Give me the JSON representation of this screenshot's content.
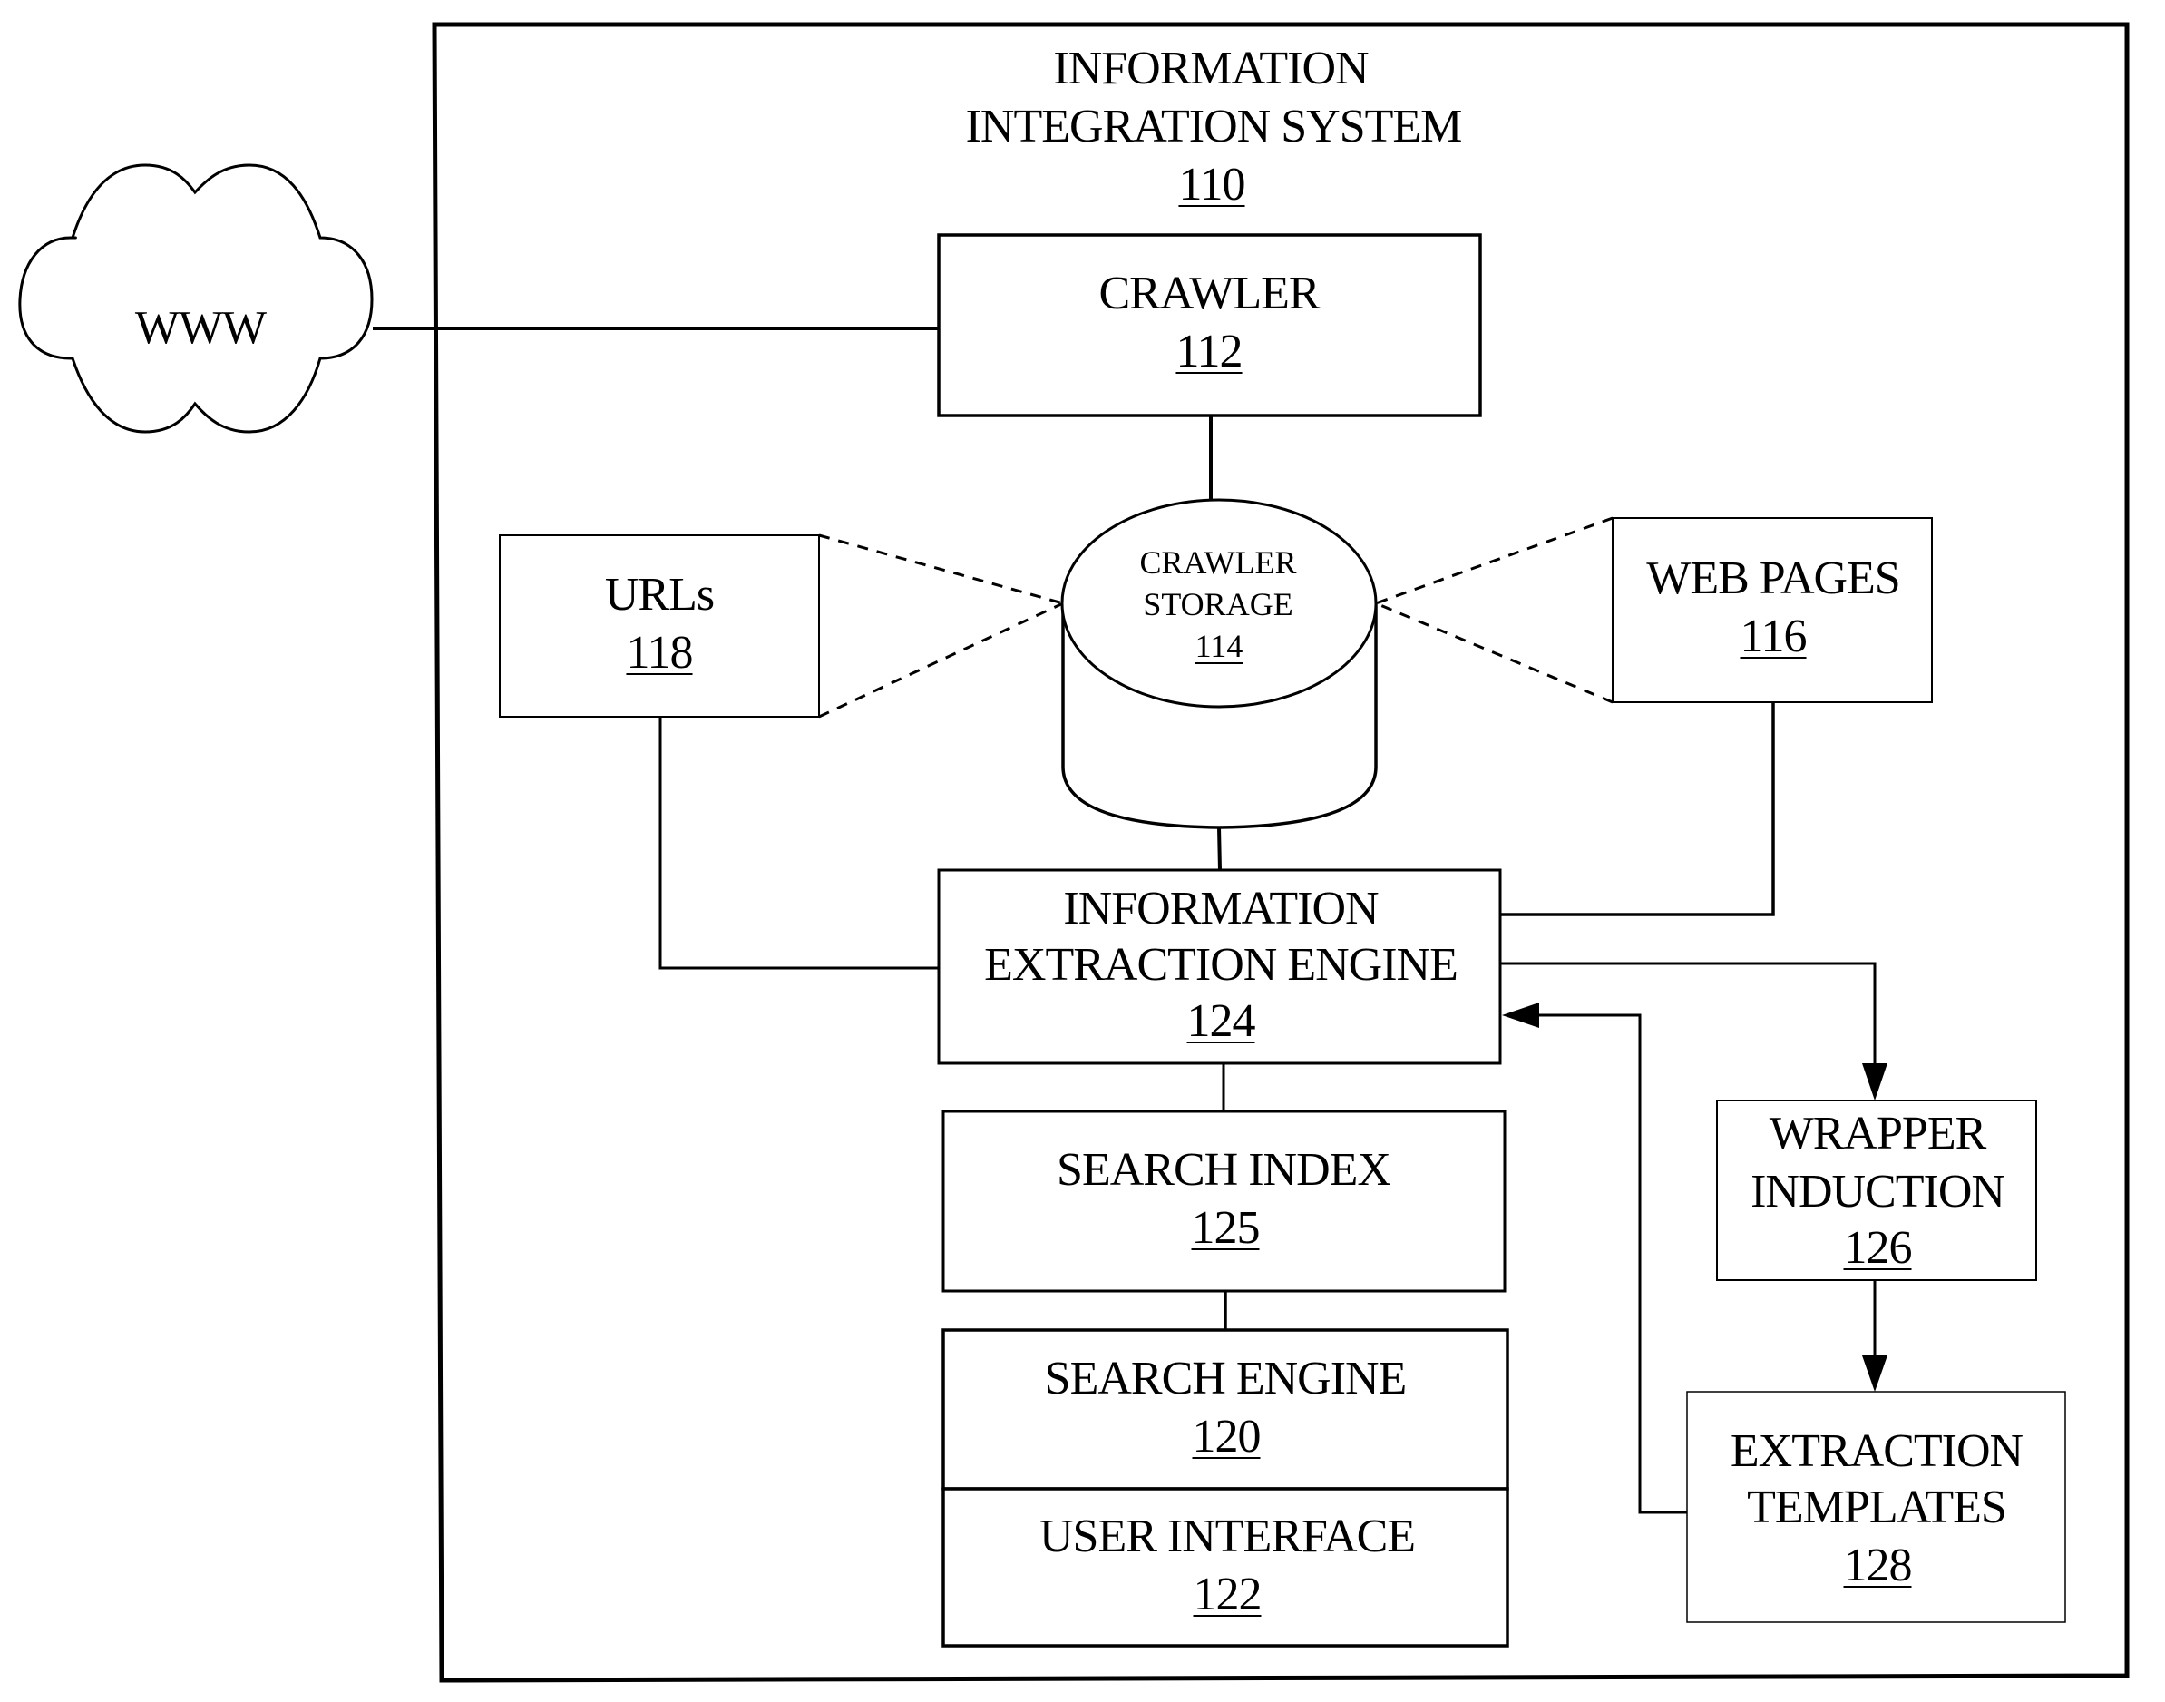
{
  "system": {
    "title_line1": "INFORMATION",
    "title_line2": "INTEGRATION SYSTEM",
    "ref": "110"
  },
  "nodes": {
    "www": {
      "label": "WWW"
    },
    "crawler": {
      "label": "CRAWLER",
      "ref": "112"
    },
    "crawler_storage": {
      "label_line1": "CRAWLER",
      "label_line2": "STORAGE",
      "ref": "114"
    },
    "urls": {
      "label": "URLs",
      "ref": "118"
    },
    "web_pages": {
      "label": "WEB PAGES",
      "ref": "116"
    },
    "extraction_engine": {
      "label_line1": "INFORMATION",
      "label_line2": "EXTRACTION ENGINE",
      "ref": "124"
    },
    "search_index": {
      "label": "SEARCH INDEX",
      "ref": "125"
    },
    "search_engine": {
      "label": "SEARCH ENGINE",
      "ref": "120"
    },
    "user_interface": {
      "label": "USER INTERFACE",
      "ref": "122"
    },
    "wrapper_induction": {
      "label_line1": "WRAPPER",
      "label_line2": "INDUCTION",
      "ref": "126"
    },
    "extraction_templates": {
      "label_line1": "EXTRACTION",
      "label_line2": "TEMPLATES",
      "ref": "128"
    }
  },
  "edges": [
    {
      "from": "www",
      "to": "crawler",
      "style": "solid",
      "arrow": false
    },
    {
      "from": "crawler",
      "to": "crawler_storage",
      "style": "solid",
      "arrow": false
    },
    {
      "from": "urls",
      "to": "crawler_storage",
      "style": "dashed",
      "arrow": false
    },
    {
      "from": "web_pages",
      "to": "crawler_storage",
      "style": "dashed",
      "arrow": false
    },
    {
      "from": "crawler_storage",
      "to": "extraction_engine",
      "style": "solid",
      "arrow": false
    },
    {
      "from": "urls",
      "to": "extraction_engine",
      "style": "solid",
      "arrow": false
    },
    {
      "from": "web_pages",
      "to": "extraction_engine",
      "style": "solid",
      "arrow": false
    },
    {
      "from": "extraction_engine",
      "to": "wrapper_induction",
      "style": "solid",
      "arrow": true
    },
    {
      "from": "wrapper_induction",
      "to": "extraction_templates",
      "style": "solid",
      "arrow": true
    },
    {
      "from": "extraction_templates",
      "to": "extraction_engine",
      "style": "solid",
      "arrow": true
    },
    {
      "from": "extraction_engine",
      "to": "search_index",
      "style": "solid",
      "arrow": false
    },
    {
      "from": "search_index",
      "to": "search_engine",
      "style": "solid",
      "arrow": false
    }
  ]
}
